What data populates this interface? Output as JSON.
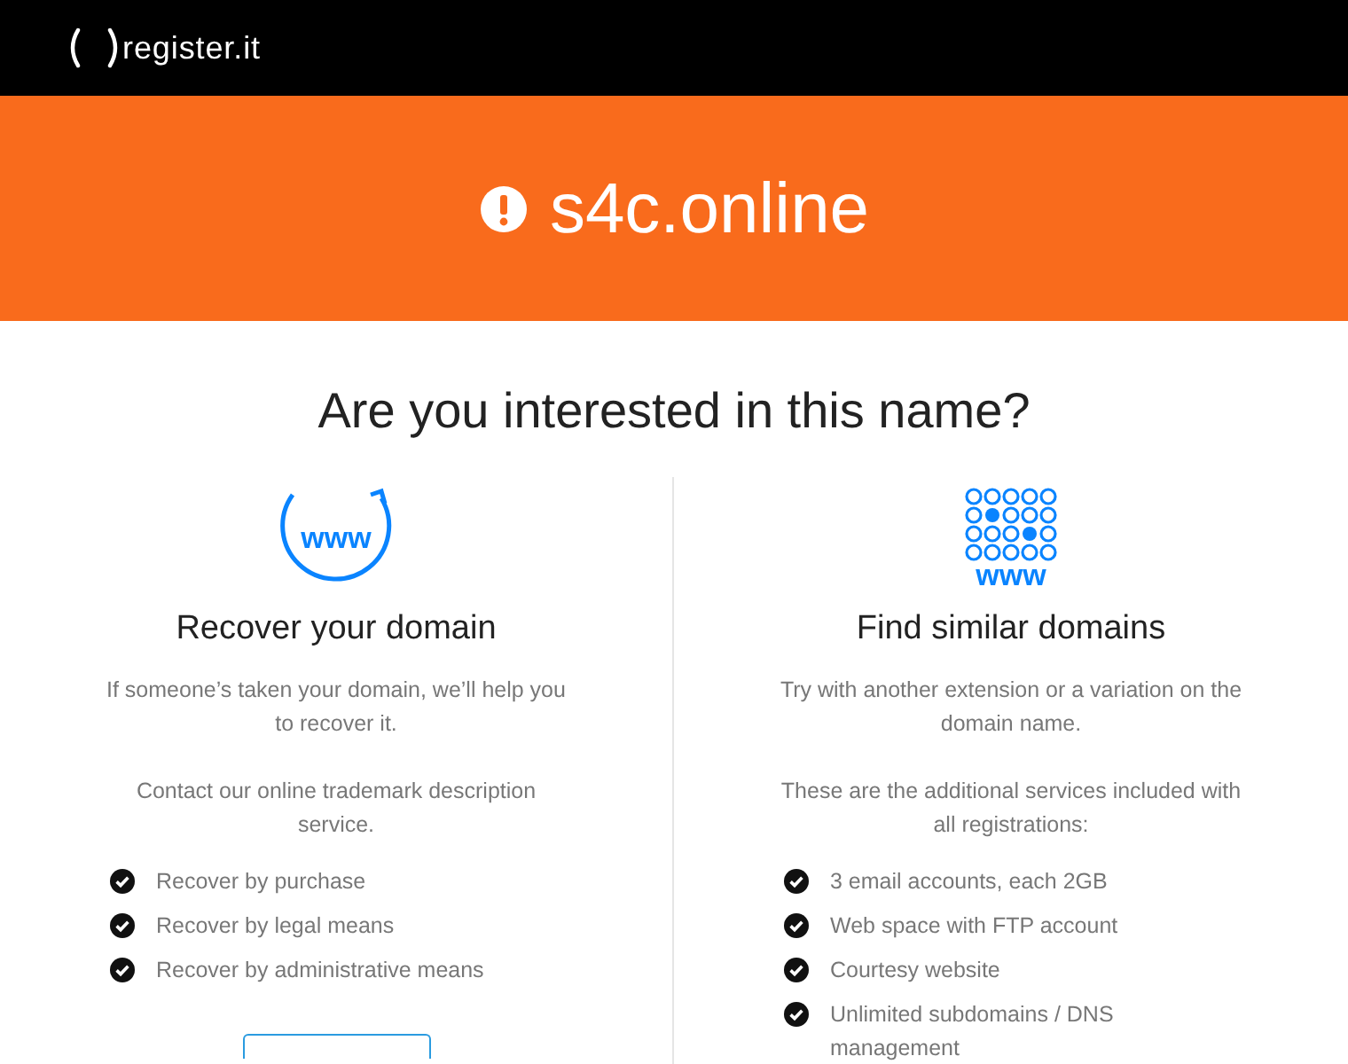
{
  "header": {
    "logo_text": "register.it"
  },
  "banner": {
    "domain": "s4c.online"
  },
  "heading": "Are you interested in this name?",
  "columns": [
    {
      "kind": "recover",
      "icon_text": "www",
      "title": "Recover your domain",
      "paragraphs": [
        "If someone’s taken your domain, we’ll help you to recover it.",
        "Contact our online trademark description service."
      ],
      "items": [
        "Recover by purchase",
        "Recover by legal means",
        "Recover by administrative means"
      ]
    },
    {
      "kind": "similar",
      "icon_text": "www",
      "title": "Find similar domains",
      "paragraphs": [
        "Try with another extension or a variation on the domain name.",
        "These are the additional services included with all registrations:"
      ],
      "items": [
        "3 email accounts, each 2GB",
        "Web space with FTP account",
        "Courtesy website",
        "Unlimited subdomains / DNS management"
      ]
    }
  ]
}
